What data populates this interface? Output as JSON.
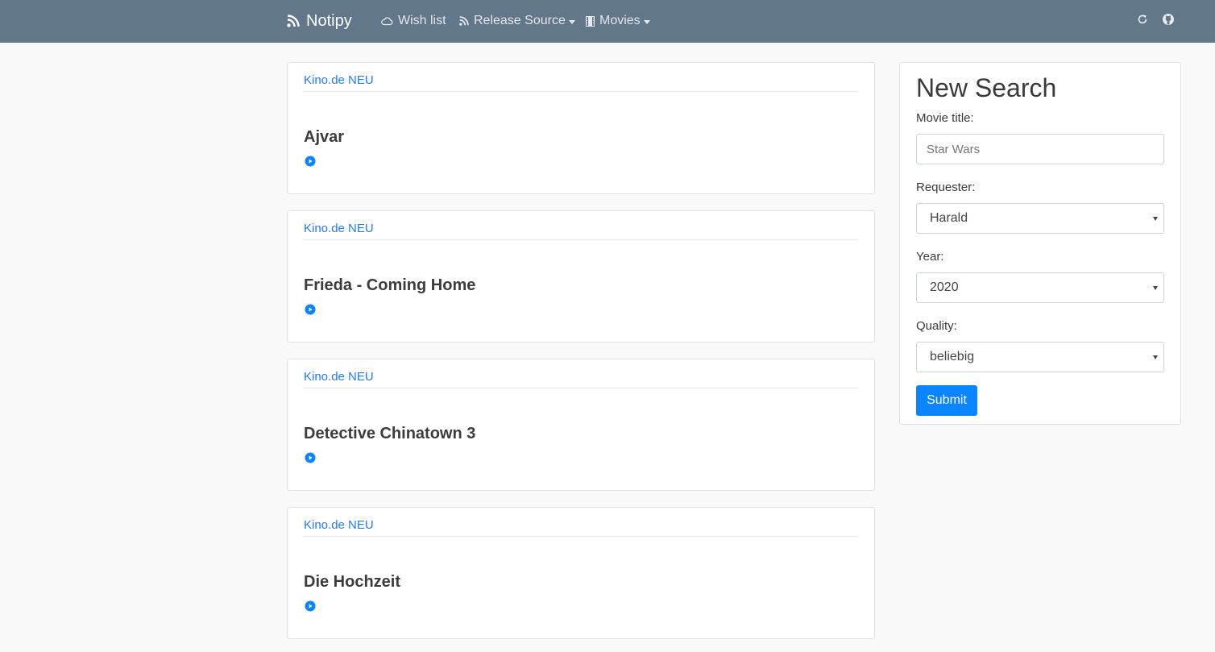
{
  "navbar": {
    "brand": "Notipy",
    "items": [
      {
        "label": "Wish list",
        "icon": "cloud-icon"
      },
      {
        "label": "Release Source",
        "icon": "rss-icon",
        "dropdown": true
      },
      {
        "label": "Movies",
        "icon": "film-icon",
        "dropdown": true
      }
    ],
    "right_icons": [
      "refresh-icon",
      "github-icon"
    ]
  },
  "releases": [
    {
      "source": "Kino.de NEU",
      "title": "Ajvar"
    },
    {
      "source": "Kino.de NEU",
      "title": "Frieda - Coming Home"
    },
    {
      "source": "Kino.de NEU",
      "title": "Detective Chinatown 3"
    },
    {
      "source": "Kino.de NEU",
      "title": "Die Hochzeit"
    }
  ],
  "search": {
    "heading": "New Search",
    "movie_title_label": "Movie title:",
    "movie_title_placeholder": "Star Wars",
    "requester_label": "Requester:",
    "requester_value": "Harald",
    "year_label": "Year:",
    "year_value": "2020",
    "quality_label": "Quality:",
    "quality_value": "beliebig",
    "submit_label": "Submit"
  },
  "colors": {
    "navbar": "#62778a",
    "accent": "#0a84ff",
    "link": "#2a7ae2"
  }
}
